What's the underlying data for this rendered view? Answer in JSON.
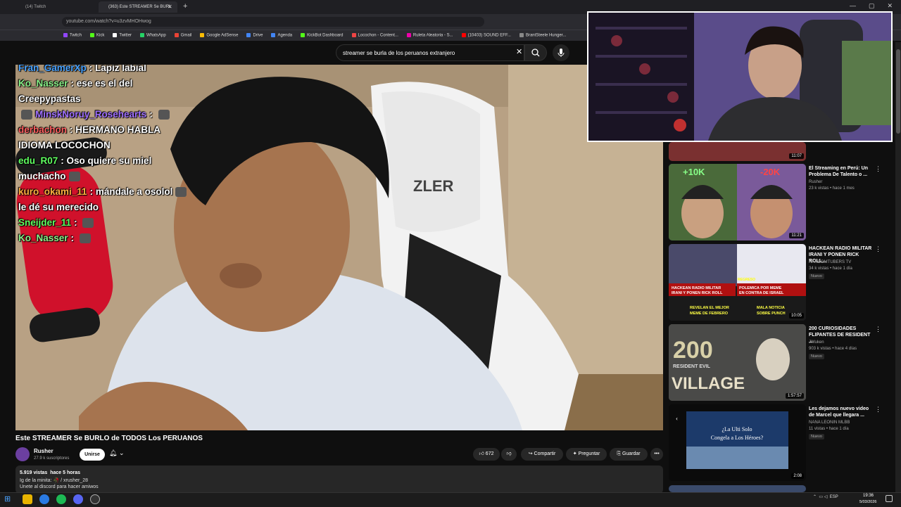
{
  "browser": {
    "tabs": [
      {
        "label": "(14) Twitch"
      },
      {
        "label": "(363) Este STREAMER Se BURL"
      }
    ],
    "new_tab": "+",
    "address": "youtube.com/watch?v=u3zvMHOHwog",
    "bookmarks": [
      {
        "label": "Twitch",
        "color": "#9146ff"
      },
      {
        "label": "Kick",
        "color": "#53fc18"
      },
      {
        "label": "Twitter",
        "color": "#ffffff"
      },
      {
        "label": "WhatsApp",
        "color": "#25d366"
      },
      {
        "label": "Gmail",
        "color": "#ea4335"
      },
      {
        "label": "Google AdSense",
        "color": "#fbbc04"
      },
      {
        "label": "Drive",
        "color": "#4285f4"
      },
      {
        "label": "Agenda",
        "color": "#4285f4"
      },
      {
        "label": "KickBot Dashboard",
        "color": "#53fc18"
      },
      {
        "label": "Locochon - Content...",
        "color": "#e44"
      },
      {
        "label": "Ruleta Aleatoria - S...",
        "color": "#e0a"
      },
      {
        "label": "(10403) SOUND EFF...",
        "color": "#f00"
      },
      {
        "label": "BrantSteele Hunger...",
        "color": "#888"
      }
    ]
  },
  "youtube": {
    "search_query": "streamer se burla de los peruanos extranjero",
    "search_icon": "search-icon",
    "mic_icon": "mic-icon"
  },
  "chat": [
    {
      "user": "Fran_GamerXp",
      "text": "Lapiz labial",
      "color": "#4aa3ff"
    },
    {
      "user": "Ko_Nasser",
      "text": "ese es el del",
      "color": "#88f088"
    },
    {
      "user": "",
      "text": "Creepypastas",
      "color": "#ffffff"
    },
    {
      "user": "MinskNoruy_Rosehearts",
      "text": "",
      "color": "#a070ff"
    },
    {
      "user": "derbachon",
      "text": "HERMANO HABLA",
      "color": "#ff6060"
    },
    {
      "user": "",
      "text": "IDIOMA LOCOCHON",
      "color": "#ffffff"
    },
    {
      "user": "edu_R07",
      "text": "Oso quiere su miel",
      "color": "#60ff60"
    },
    {
      "user": "",
      "text": "muchacho",
      "color": "#ffffff"
    },
    {
      "user": "kuro_okami_11",
      "text": "mándale a osolol",
      "color": "#ffb040"
    },
    {
      "user": "",
      "text": "le dé su merecido",
      "color": "#ffffff"
    },
    {
      "user": "Sneijder_11",
      "text": "",
      "color": "#60ff60"
    },
    {
      "user": "Ko_Nasser",
      "text": "",
      "color": "#88f088"
    }
  ],
  "video": {
    "title": "Este STREAMER Se BURLO de TODOS Los PERUANOS",
    "channel": "Rusher",
    "subscribers": "27.9 k suscriptores",
    "join_label": "Unirse",
    "likes": "672",
    "share_label": "Compartir",
    "ask_label": "Preguntar",
    "save_label": "Guardar",
    "views": "5.919 vistas",
    "time_ago": "hace 5 horas",
    "desc_line1": "Ig de la minita: 🥀 / xrusher_28",
    "desc_line2": "Unete al discord para hacer amiwos"
  },
  "recommendations": [
    {
      "title": "",
      "channel": "",
      "meta": "",
      "duration": "11:07",
      "badge": ""
    },
    {
      "title": "El Streaming en Perú: Un Problema De Talento o ...",
      "channel": "Rusher",
      "meta": "23 k vistas • hace 1 mes",
      "duration": "11:21",
      "badge": ""
    },
    {
      "title": "HACKEAN RADIO MILITAR IRANI Y PONEN RICK ROLL...",
      "channel": "RANDOMTUBERS TV",
      "meta": "34 k vistas • hace 1 día",
      "duration": "10:05",
      "badge": "Nuevo"
    },
    {
      "title": "200 CURIOSIDADES FLIPANTES DE RESIDENT ...",
      "channel": "JWuken",
      "meta": "903 k vistas • hace 4 días",
      "duration": "1:57:57",
      "badge": "Nuevo"
    },
    {
      "title": "Les dejamos nuevo video de Marcel que llegara ...",
      "channel": "NANA LEONIN MLBB",
      "meta": "11 vistas • hace 1 día",
      "duration": "2:08",
      "badge": "Nuevo"
    }
  ],
  "thumb_text": {
    "t2_left": "+10K",
    "t2_right": "-20K",
    "t3_a": "HACKEAN RADIO MILITAR",
    "t3_b": "IRANI Y PONEN RICK ROLL",
    "t3_c": "REGRESO",
    "t3_d": "POLEMICA POR MEME",
    "t3_e": "EN CONTRA DE ISRAEL",
    "t3_f": "REVELAN EL MEJOR",
    "t3_g": "MEME DE FEBRERO",
    "t3_h": "MALA NOTICIA",
    "t3_i": "SOBRE PUNCH",
    "t4_a": "200",
    "t4_b": "RESIDENT EVIL",
    "t4_c": "VILLAGE",
    "t5_a": "¿La Ulti Solo",
    "t5_b": "Congela a Los Héroes?"
  },
  "taskbar": {
    "lang": "ESP",
    "time": "19:36",
    "date": "5/03/2026"
  }
}
